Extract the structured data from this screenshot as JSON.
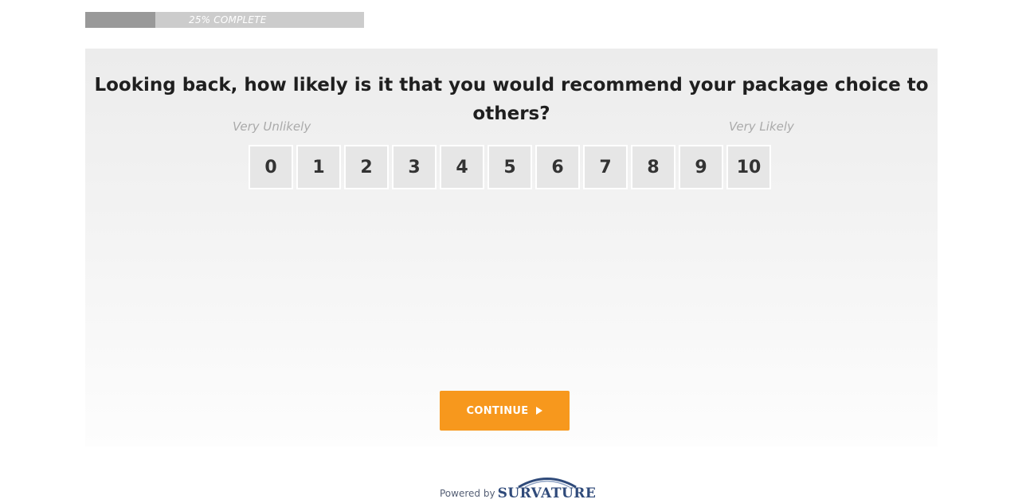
{
  "progress": {
    "label": "25% COMPLETE",
    "fraction": 0.25,
    "colors": {
      "fill": "#999999",
      "track": "#cccccc"
    }
  },
  "question": {
    "text": "Looking back, how likely is it that you would recommend your package choice to others?",
    "anchor_low": "Very Unlikely",
    "anchor_high": "Very Likely",
    "options": [
      "0",
      "1",
      "2",
      "3",
      "4",
      "5",
      "6",
      "7",
      "8",
      "9",
      "10"
    ]
  },
  "actions": {
    "continue_label": "CONTINUE",
    "continue_icon": "play-arrow-icon",
    "accent_color": "#f7981d"
  },
  "footer": {
    "powered_by": "Powered by",
    "brand": "SURVATURE",
    "brand_color": "#2f4a7a"
  }
}
